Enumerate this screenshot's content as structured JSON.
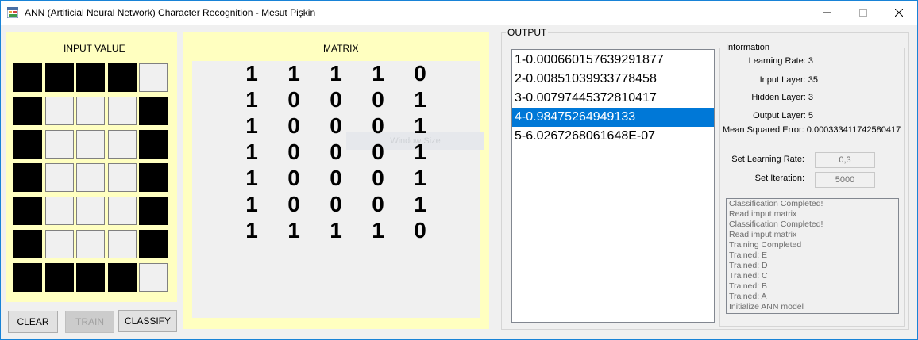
{
  "window": {
    "title": "ANN (Artificial Neural Network) Character Recognition - Mesut Pişkin",
    "app_icon": "app-form-icon",
    "controls": [
      "minimize-icon",
      "maximize-icon",
      "close-icon"
    ]
  },
  "input_panel": {
    "label": "INPUT VALUE",
    "grid": [
      [
        1,
        1,
        1,
        1,
        0
      ],
      [
        1,
        0,
        0,
        0,
        1
      ],
      [
        1,
        0,
        0,
        0,
        1
      ],
      [
        1,
        0,
        0,
        0,
        1
      ],
      [
        1,
        0,
        0,
        0,
        1
      ],
      [
        1,
        0,
        0,
        0,
        1
      ],
      [
        1,
        1,
        1,
        1,
        0
      ]
    ]
  },
  "buttons": {
    "clear": "CLEAR",
    "train": "TRAIN",
    "classify": "CLASSIFY"
  },
  "matrix_panel": {
    "label": "MATRIX",
    "ghost_text": "Window Size"
  },
  "output": {
    "label": "OUTPUT",
    "items": [
      "1-0.000660157639291877",
      "2-0.00851039933778458",
      "3-0.00797445372810417",
      "4-0.98475264949133",
      "5-6.0267268061648E-07"
    ],
    "selected_index": 3
  },
  "information": {
    "label": "Information",
    "learning_rate": "Learning Rate: 3",
    "input_layer": "Input Layer: 35",
    "hidden_layer": "Hidden Layer: 3",
    "output_layer": "Output Layer: 5",
    "mse": "Mean Squared Error: 0.000333411742580417",
    "set_learning_rate_label": "Set Learning Rate:",
    "set_learning_rate_value": "0,3",
    "set_iteration_label": "Set Iteration:",
    "set_iteration_value": "5000",
    "log": [
      "Classification Completed!",
      "Read imput matrix",
      "Classification Completed!",
      "Read imput matrix",
      "Training Completed",
      "Trained: E",
      "Trained: D",
      "Trained: C",
      "Trained: B",
      "Trained: A",
      "Initialize ANN model"
    ]
  }
}
